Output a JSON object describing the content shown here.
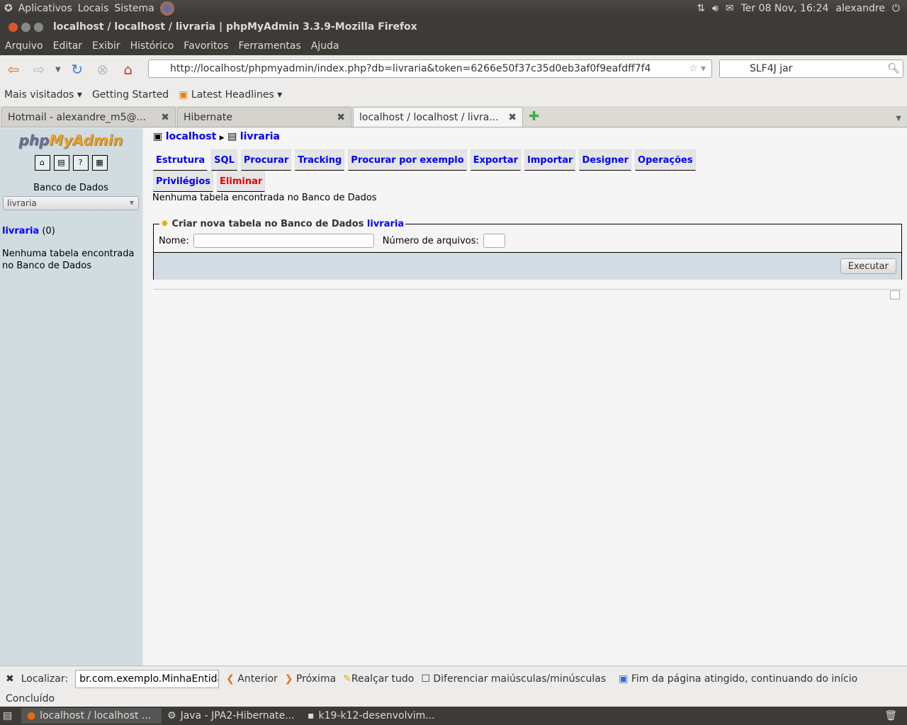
{
  "top_panel": {
    "menus": [
      "Aplicativos",
      "Locais",
      "Sistema"
    ],
    "datetime": "Ter 08 Nov, 16:24",
    "user": "alexandre"
  },
  "window_title": "localhost / localhost / livraria | phpMyAdmin 3.3.9-Mozilla Firefox",
  "menu": [
    "Arquivo",
    "Editar",
    "Exibir",
    "Histórico",
    "Favoritos",
    "Ferramentas",
    "Ajuda"
  ],
  "url": "http://localhost/phpmyadmin/index.php?db=livraria&token=6266e50f37c35d0eb3af0f9eafdff7f4",
  "search_value": "SLF4J jar",
  "bookmarks": [
    "Mais visitados",
    "Getting Started",
    "Latest Headlines"
  ],
  "tabs": [
    "Hotmail - alexandre_m5@...",
    "Hibernate",
    "localhost / localhost / livra..."
  ],
  "sidebar": {
    "logo": "phpMyAdmin",
    "db_label": "Banco de Dados",
    "db_select": "livraria",
    "db_link": "livraria",
    "db_count": "(0)",
    "empty": "Nenhuma tabela encontrada no Banco de Dados"
  },
  "breadcrumb": {
    "server": "localhost",
    "db": "livraria"
  },
  "pma_tabs": [
    "Estrutura",
    "SQL",
    "Procurar",
    "Tracking",
    "Procurar por exemplo",
    "Exportar",
    "Importar",
    "Designer",
    "Operações"
  ],
  "pma_tabs2": [
    "Privilégios",
    "Eliminar"
  ],
  "message": "Nenhuma tabela encontrada no Banco de Dados",
  "create": {
    "legend": "Criar nova tabela no Banco de Dados",
    "legend_db": "livraria",
    "name_label": "Nome:",
    "name_value": "",
    "files_label": "Número de arquivos:",
    "files_value": "",
    "submit": "Executar"
  },
  "findbar": {
    "label": "Localizar:",
    "value": "br.com.exemplo.MinhaEntida",
    "prev": "Anterior",
    "next": "Próxima",
    "highlight": "Realçar tudo",
    "match_case": "Diferenciar maiúsculas/minúsculas",
    "notice": "Fim da página atingido, continuando do início"
  },
  "status": "Concluído",
  "taskbar": [
    "localhost / localhost ...",
    "Java - JPA2-Hibernate...",
    "k19-k12-desenvolvim..."
  ]
}
